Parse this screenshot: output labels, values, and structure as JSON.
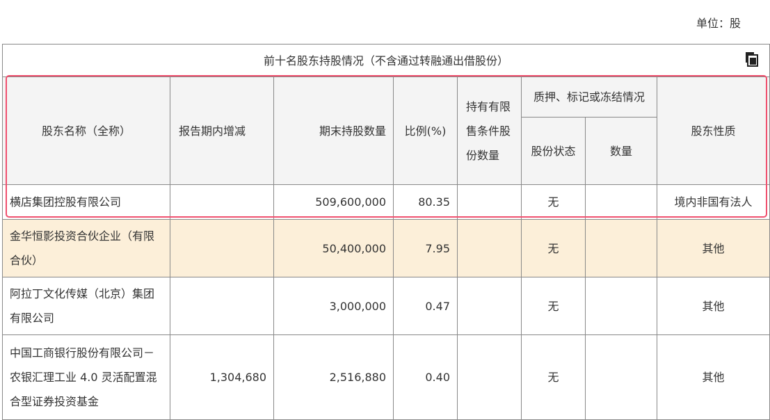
{
  "unit_label": "单位：股",
  "table": {
    "caption": "前十名股东持股情况（不含通过转融通出借股份）",
    "headers": {
      "name": "股东名称（全称）",
      "change": "报告期内增减",
      "end_holdings": "期末持股数量",
      "ratio": "比例(%)",
      "restricted": "持有有限售条件股份数量",
      "pledge_group": "质押、标记或冻结情况",
      "pledge_status": "股份状态",
      "pledge_qty": "数量",
      "nature": "股东性质"
    },
    "rows": [
      {
        "name": "横店集团控股有限公司",
        "change": "",
        "end_holdings": "509,600,000",
        "ratio": "80.35",
        "restricted": "",
        "status": "无",
        "qty": "",
        "nature": "境内非国有法人"
      },
      {
        "name": "金华恒影投资合伙企业（有限合伙）",
        "change": "",
        "end_holdings": "50,400,000",
        "ratio": "7.95",
        "restricted": "",
        "status": "无",
        "qty": "",
        "nature": "其他"
      },
      {
        "name": "阿拉丁文化传媒（北京）集团有限公司",
        "change": "",
        "end_holdings": "3,000,000",
        "ratio": "0.47",
        "restricted": "",
        "status": "无",
        "qty": "",
        "nature": "其他"
      },
      {
        "name": "中国工商银行股份有限公司－农银汇理工业 4.0 灵活配置混合型证券投资基金",
        "change": "1,304,680",
        "end_holdings": "2,516,880",
        "ratio": "0.40",
        "restricted": "",
        "status": "无",
        "qty": "",
        "nature": "其他"
      }
    ]
  },
  "icons": {
    "copy": "copy-icon"
  },
  "colors": {
    "highlight": "#f0506e",
    "row_alt": "#fcefd9",
    "header_bg": "#f4f4f4"
  }
}
